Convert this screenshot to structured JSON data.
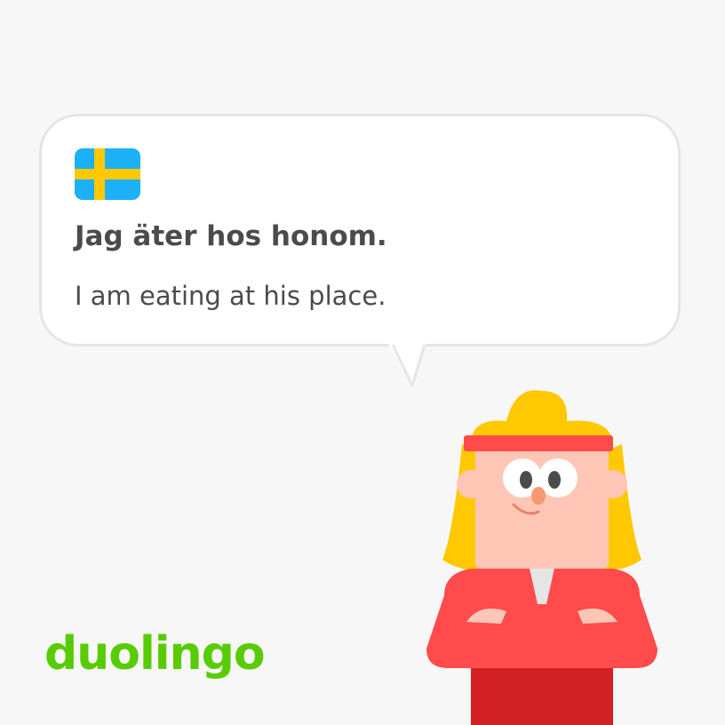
{
  "card": {
    "language_flag": "sweden-flag-icon",
    "sentence": "Jag äter hos honom.",
    "translation": "I am eating at his place."
  },
  "brand": {
    "logo_text": "duolingo",
    "logo_color": "#58cc02"
  },
  "character": {
    "name": "character-illustration",
    "shirt_color": "#ff4b4b",
    "hair_color": "#ffc800"
  }
}
